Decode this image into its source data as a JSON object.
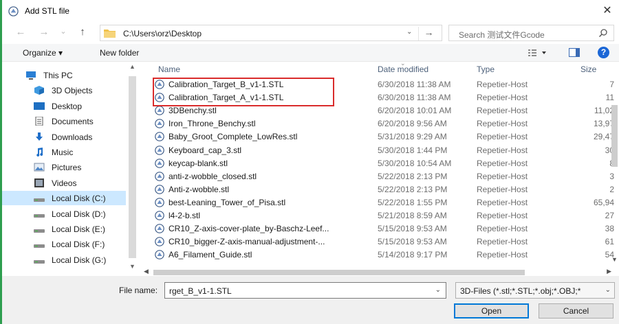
{
  "window": {
    "title": "Add STL file",
    "close_glyph": "✕"
  },
  "nav": {
    "back_glyph": "←",
    "forward_glyph": "→",
    "recent_glyph": "⌄",
    "up_glyph": "↑",
    "address": "C:\\Users\\orz\\Desktop",
    "address_dropdown_glyph": "⌄",
    "go_glyph": "→",
    "search_placeholder": "Search 测试文件Gcode"
  },
  "toolbar": {
    "organize": "Organize ▾",
    "new_folder": "New folder",
    "help": "?"
  },
  "sidebar": {
    "items": [
      {
        "label": "This PC",
        "icon": "pc-icon",
        "top": true
      },
      {
        "label": "3D Objects",
        "icon": "cube-icon"
      },
      {
        "label": "Desktop",
        "icon": "desktop-icon"
      },
      {
        "label": "Documents",
        "icon": "documents-icon"
      },
      {
        "label": "Downloads",
        "icon": "downloads-icon"
      },
      {
        "label": "Music",
        "icon": "music-icon"
      },
      {
        "label": "Pictures",
        "icon": "pictures-icon"
      },
      {
        "label": "Videos",
        "icon": "videos-icon"
      },
      {
        "label": "Local Disk (C:)",
        "icon": "drive-icon",
        "selected": true
      },
      {
        "label": "Local Disk (D:)",
        "icon": "drive-icon"
      },
      {
        "label": "Local Disk (E:)",
        "icon": "drive-icon"
      },
      {
        "label": "Local Disk (F:)",
        "icon": "drive-icon"
      },
      {
        "label": "Local Disk (G:)",
        "icon": "drive-icon"
      }
    ]
  },
  "file_list": {
    "columns": {
      "name": "Name",
      "date": "Date modified",
      "type": "Type",
      "size": "Size"
    },
    "rows": [
      {
        "name": "Calibration_Target_B_v1-1.STL",
        "date": "6/30/2018 11:38 AM",
        "type": "Repetier-Host",
        "size": "7"
      },
      {
        "name": "Calibration_Target_A_v1-1.STL",
        "date": "6/30/2018 11:38 AM",
        "type": "Repetier-Host",
        "size": "11"
      },
      {
        "name": "3DBenchy.stl",
        "date": "6/20/2018 10:01 AM",
        "type": "Repetier-Host",
        "size": "11,02"
      },
      {
        "name": "Iron_Throne_Benchy.stl",
        "date": "6/20/2018 9:56 AM",
        "type": "Repetier-Host",
        "size": "13,97"
      },
      {
        "name": "Baby_Groot_Complete_LowRes.stl",
        "date": "5/31/2018 9:29 AM",
        "type": "Repetier-Host",
        "size": "29,47"
      },
      {
        "name": "Keyboard_cap_3.stl",
        "date": "5/30/2018 1:44 PM",
        "type": "Repetier-Host",
        "size": "30"
      },
      {
        "name": "keycap-blank.stl",
        "date": "5/30/2018 10:54 AM",
        "type": "Repetier-Host",
        "size": "8"
      },
      {
        "name": "anti-z-wobble_closed.stl",
        "date": "5/22/2018 2:13 PM",
        "type": "Repetier-Host",
        "size": "3"
      },
      {
        "name": "Anti-z-wobble.stl",
        "date": "5/22/2018 2:13 PM",
        "type": "Repetier-Host",
        "size": "2"
      },
      {
        "name": "best-Leaning_Tower_of_Pisa.stl",
        "date": "5/22/2018 1:55 PM",
        "type": "Repetier-Host",
        "size": "65,94"
      },
      {
        "name": "l4-2-b.stl",
        "date": "5/21/2018 8:59 AM",
        "type": "Repetier-Host",
        "size": "27"
      },
      {
        "name": "CR10_Z-axis-cover-plate_by-Baschz-Leef...",
        "date": "5/15/2018 9:53 AM",
        "type": "Repetier-Host",
        "size": "38"
      },
      {
        "name": "CR10_bigger-Z-axis-manual-adjustment-...",
        "date": "5/15/2018 9:53 AM",
        "type": "Repetier-Host",
        "size": "61"
      },
      {
        "name": "A6_Filament_Guide.stl",
        "date": "5/14/2018 9:17 PM",
        "type": "Repetier-Host",
        "size": "54"
      }
    ]
  },
  "bottom": {
    "file_name_label": "File name:",
    "file_name_value": "rget_B_v1-1.STL",
    "filter_value": "3D-Files (*.stl;*.STL;*.obj;*.OBJ;*",
    "open_label": "Open",
    "cancel_label": "Cancel"
  },
  "colors": {
    "accent": "#0078d7",
    "highlight_box": "#d92b2b",
    "selected_bg": "#cce8ff",
    "folder": "#f0c24b"
  }
}
